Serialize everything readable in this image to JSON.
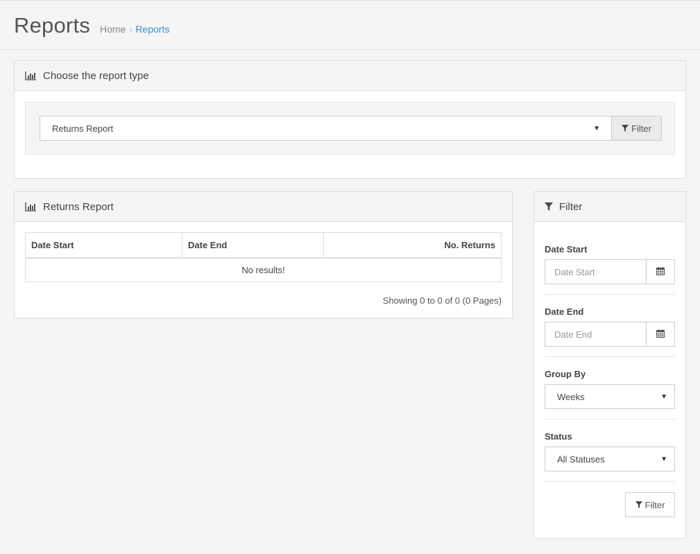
{
  "header": {
    "title": "Reports",
    "breadcrumb": {
      "home": "Home",
      "separator": "›",
      "current": "Reports"
    }
  },
  "report_type_panel": {
    "heading": "Choose the report type",
    "heading_icon": "bar-chart-icon",
    "selected_report": "Returns Report",
    "filter_button": "Filter"
  },
  "returns_panel": {
    "heading": "Returns Report",
    "heading_icon": "bar-chart-icon",
    "columns": [
      "Date Start",
      "Date End",
      "No. Returns"
    ],
    "empty_message": "No results!",
    "pagination_text": "Showing 0 to 0 of 0 (0 Pages)"
  },
  "filter_panel": {
    "heading": "Filter",
    "heading_icon": "filter-icon",
    "date_start": {
      "label": "Date Start",
      "placeholder": "Date Start"
    },
    "date_end": {
      "label": "Date End",
      "placeholder": "Date End"
    },
    "group_by": {
      "label": "Group By",
      "value": "Weeks"
    },
    "status": {
      "label": "Status",
      "value": "All Statuses"
    },
    "filter_button": "Filter"
  },
  "colors": {
    "background": "#f5f5f5",
    "link": "#3a8dc9",
    "border": "#dddddd"
  }
}
